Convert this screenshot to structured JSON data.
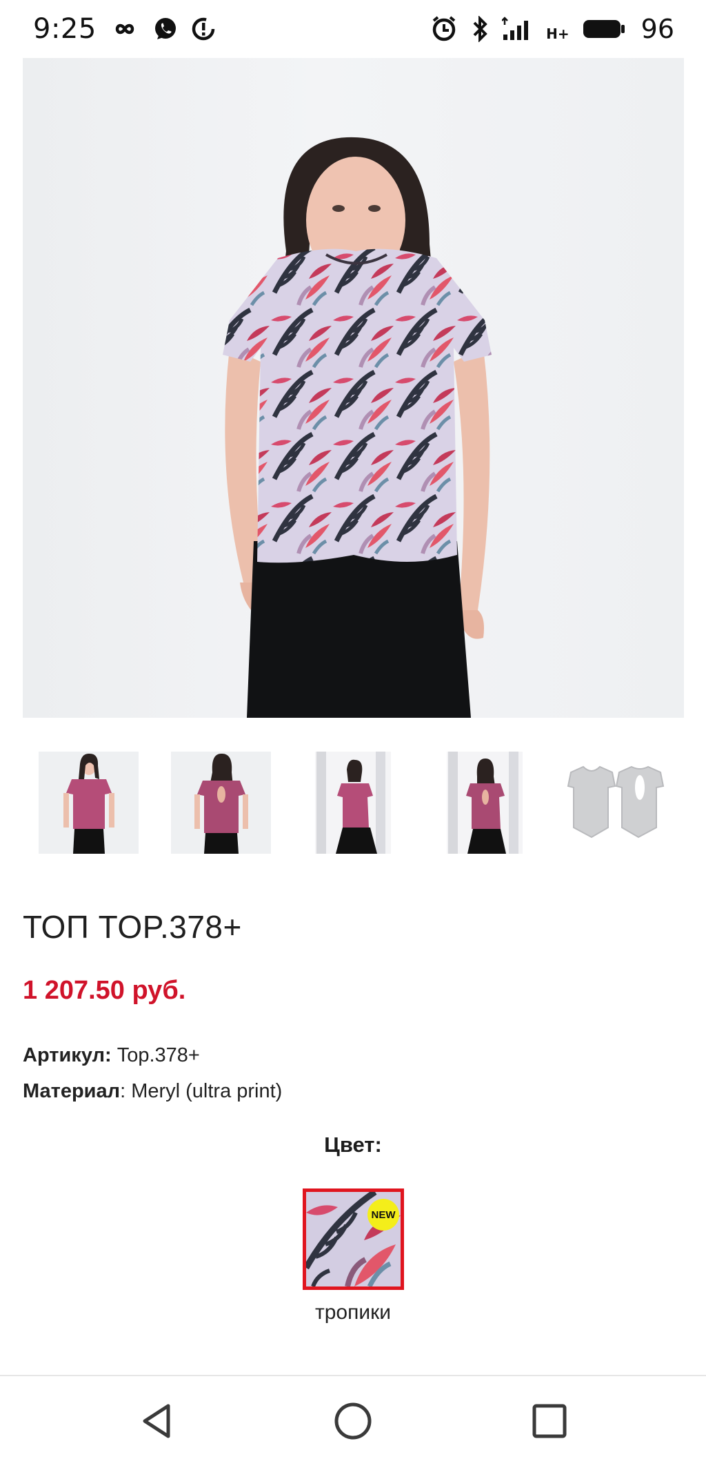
{
  "status_bar": {
    "time": "9:25",
    "battery": "96",
    "network": "H+",
    "icons": [
      "infinity-icon",
      "whatsapp-icon",
      "data-saver-icon",
      "alarm-icon",
      "bluetooth-icon",
      "signal-icon",
      "battery-icon"
    ]
  },
  "gallery": {
    "thumbnail_count": 5,
    "thumbnail_names": [
      "front-view",
      "back-view",
      "interior-front-view",
      "interior-back-view",
      "sketch-view"
    ]
  },
  "product": {
    "title": "ТОП TOP.378+",
    "price": "1 207.50 руб.",
    "article_label": "Артикул:",
    "article_value": " Top.378+",
    "material_label": "Материал",
    "material_value": ": Meryl (ultra print)",
    "color_heading": "Цвет:",
    "color_badge": "NEW",
    "color_name": "тропики"
  },
  "colors": {
    "price": "#d0132a",
    "swatch_border": "#e0151f",
    "badge": "#f4ee1a"
  },
  "nav": {
    "icons": [
      "back-icon",
      "home-icon",
      "recents-icon"
    ]
  }
}
